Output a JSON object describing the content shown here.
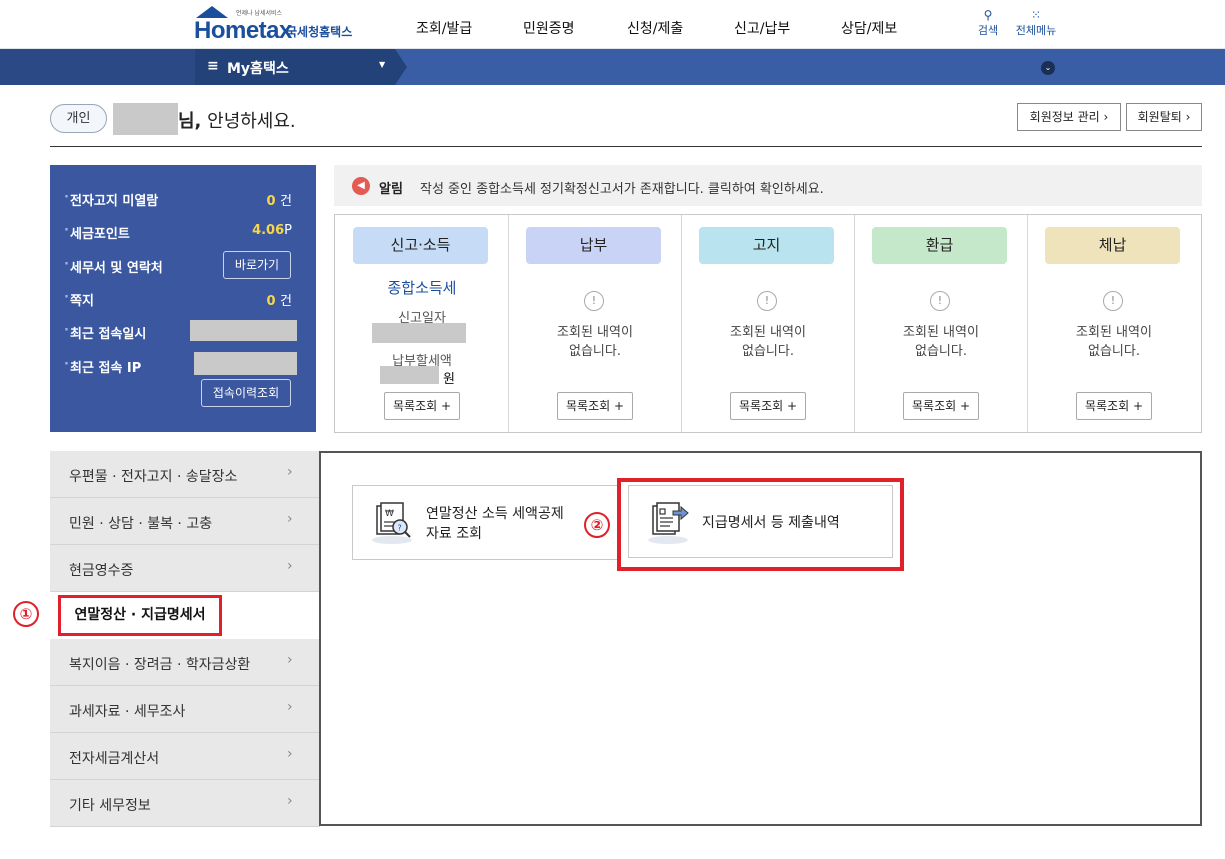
{
  "header": {
    "logo_text": "Hometax",
    "logo_kr": "국세청홈택스",
    "logo_sub": "언제나 납세서비스",
    "nav": [
      "조회/발급",
      "민원증명",
      "신청/제출",
      "신고/납부",
      "상담/제보"
    ],
    "search_label": "검색",
    "allmenu_label": "전체메뉴"
  },
  "band": {
    "tab_label": "My홈택스"
  },
  "greeting": {
    "user_type": "개인",
    "suffix_bold": "님,",
    "text": " 안녕하세요.",
    "buttons": [
      "회원정보 관리 ›",
      "회원탈퇴 ›"
    ]
  },
  "info": {
    "rows": [
      {
        "label": "전자고지 미열람",
        "value": "0",
        "unit": "건"
      },
      {
        "label": "세금포인트",
        "value": "4.06",
        "unit": "P"
      },
      {
        "label": "세무서 및 연락처",
        "button": "바로가기"
      },
      {
        "label": "쪽지",
        "value": "0",
        "unit": "건"
      },
      {
        "label": "최근 접속일시"
      },
      {
        "label": "최근 접속 IP"
      }
    ],
    "history_button": "접속이력조회"
  },
  "alert": {
    "label": "알림",
    "text": "작성 중인 종합소득세 정기확정신고서가 존재합니다. 클릭하여 확인하세요."
  },
  "cards": [
    {
      "title": "신고·소득",
      "color": "#c6dcf6",
      "main": "종합소득세",
      "sub1": "신고일자",
      "sub2": "납부할세액",
      "unit": "원",
      "button": "목록조회 +"
    },
    {
      "title": "납부",
      "color": "#c8d3f5",
      "empty1": "조회된 내역이",
      "empty2": "없습니다.",
      "button": "목록조회 +"
    },
    {
      "title": "고지",
      "color": "#b9e3ee",
      "empty1": "조회된 내역이",
      "empty2": "없습니다.",
      "button": "목록조회 +"
    },
    {
      "title": "환급",
      "color": "#c5e8cb",
      "empty1": "조회된 내역이",
      "empty2": "없습니다.",
      "button": "목록조회 +"
    },
    {
      "title": "체납",
      "color": "#efe3bc",
      "empty1": "조회된 내역이",
      "empty2": "없습니다.",
      "button": "목록조회 +"
    }
  ],
  "lnb": {
    "items": [
      "우편물 · 전자고지 · 송달장소",
      "민원 · 상담 · 불복 · 고충",
      "현금영수증",
      "연말정산 · 지급명세서",
      "복지이음 · 장려금 · 학자금상환",
      "과세자료 · 세무조사",
      "전자세금계산서",
      "기타 세무정보"
    ],
    "active_index": 3
  },
  "services": [
    {
      "line1": "연말정산 소득 세액공제",
      "line2": "자료 조회",
      "icon": "document-search-icon"
    },
    {
      "line1": "지급명세서 등 제출내역",
      "icon": "document-submit-icon"
    }
  ],
  "steps": [
    "①",
    "②"
  ],
  "colors": {
    "brand": "#1b4f9c",
    "band": "#3a5ea5",
    "panel": "#3a57a0",
    "highlight": "#e0202b"
  }
}
